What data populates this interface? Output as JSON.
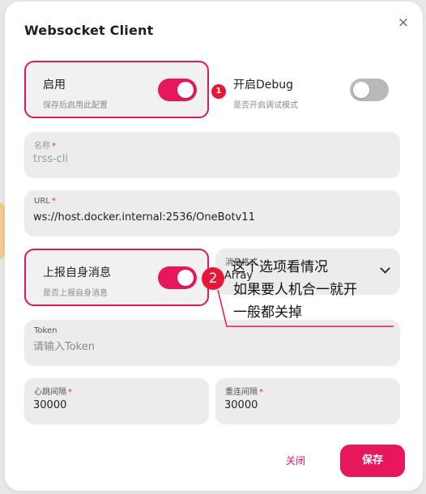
{
  "dialog": {
    "title": "Websocket Client",
    "close_symbol": "×"
  },
  "enable": {
    "title": "启用",
    "desc": "保存后启用此配置",
    "on": true
  },
  "debug": {
    "title": "开启Debug",
    "desc": "是否开启调试模式",
    "on": false
  },
  "name_field": {
    "label": "名称",
    "required_mark": "*",
    "value": "trss-cli"
  },
  "url_field": {
    "label": "URL",
    "required_mark": "*",
    "value": "ws://host.docker.internal:2536/OneBotv11"
  },
  "report_self": {
    "title": "上报自身消息",
    "desc": "是否上报自身消息",
    "on": true
  },
  "message_format": {
    "label": "消息格式",
    "value": "Array"
  },
  "token_field": {
    "label": "Token",
    "placeholder": "请输入Token"
  },
  "heartbeat_field": {
    "label": "心跳间隔",
    "required_mark": "*",
    "value": "30000"
  },
  "reconnect_field": {
    "label": "重连间隔",
    "required_mark": "*",
    "value": "30000"
  },
  "footer": {
    "close_label": "关闭",
    "save_label": "保存"
  },
  "annotations": {
    "marker1": "1",
    "marker2": "2",
    "lines": [
      "这个选项看情况",
      "如果要人机合一就开",
      "一般都关掉"
    ]
  },
  "colors": {
    "accent": "#e8175d",
    "marker": "#e8173a",
    "card_bg": "#ececec"
  }
}
